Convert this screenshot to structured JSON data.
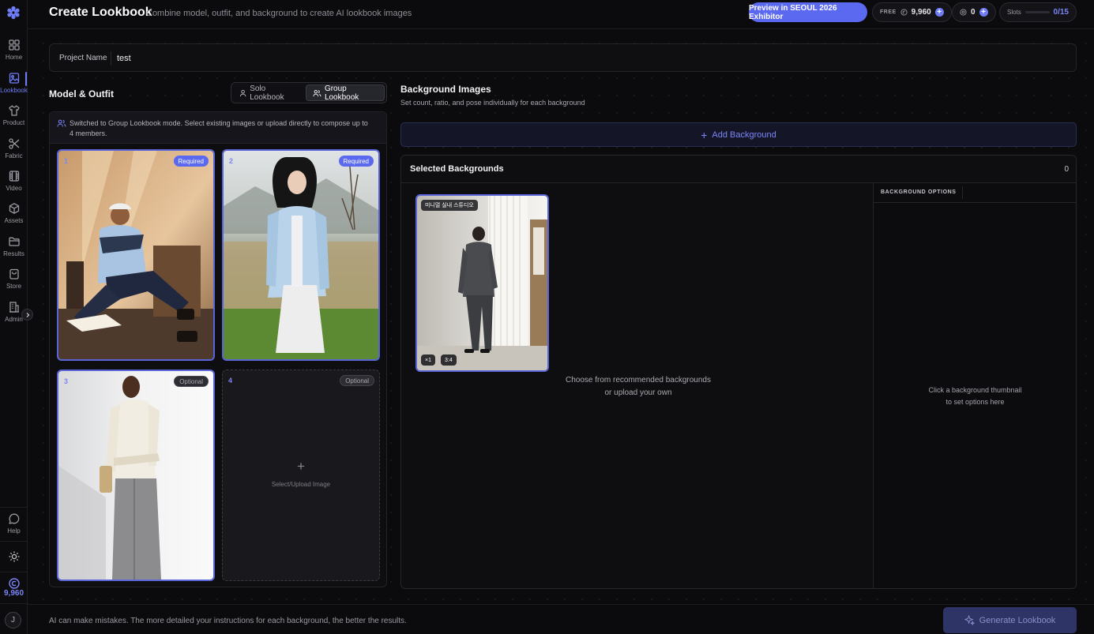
{
  "sidebar": {
    "items": [
      {
        "label": "Home",
        "icon": "home-grid-icon"
      },
      {
        "label": "Lookbook",
        "icon": "lookbook-image-icon"
      },
      {
        "label": "Product",
        "icon": "shirt-icon"
      },
      {
        "label": "Fabric",
        "icon": "scissors-icon"
      },
      {
        "label": "Video",
        "icon": "film-icon"
      },
      {
        "label": "Assets",
        "icon": "cube-icon"
      },
      {
        "label": "Results",
        "icon": "folder-icon"
      },
      {
        "label": "Store",
        "icon": "bag-icon"
      },
      {
        "label": "Admin",
        "icon": "building-icon"
      }
    ],
    "help_label": "Help",
    "credit_value": "9,960",
    "avatar_initial": "J"
  },
  "header": {
    "title": "Create Lookbook",
    "subtitle": "Combine model, outfit, and background to create AI lookbook images",
    "preview_button": "Preview in SEOUL 2026 Exhibitor",
    "plan_label": "FREE",
    "credits": "9,960",
    "coins": "0",
    "slots_label": "Slots",
    "slots_value": "0/15"
  },
  "project": {
    "label": "Project Name",
    "value": "test"
  },
  "model_outfit": {
    "title": "Model & Outfit",
    "mode_solo": "Solo Lookbook",
    "mode_group": "Group Lookbook",
    "info": "Switched to Group Lookbook mode. Select existing images or upload directly to compose up to 4 members.",
    "slots": [
      {
        "number": "1",
        "badge": "Required"
      },
      {
        "number": "2",
        "badge": "Required"
      },
      {
        "number": "3",
        "badge": "Optional"
      },
      {
        "number": "4",
        "badge": "Optional",
        "upload_label": "Select/Upload Image"
      }
    ]
  },
  "background": {
    "title": "Background Images",
    "subtitle": "Set count, ratio, and pose individually for each background",
    "add_button": "Add Background",
    "selected_title": "Selected Backgrounds",
    "selected_count": "0",
    "thumb_label": "미니멀 실내 스튜디오",
    "thumb_count": "×1",
    "thumb_ratio": "3:4",
    "choose_line1": "Choose from recommended backgrounds",
    "choose_line2": "or upload your own",
    "options_title": "BACKGROUND OPTIONS",
    "options_hint_line1": "Click a background thumbnail",
    "options_hint_line2": "to set options here"
  },
  "footer": {
    "disclaimer": "AI can make mistakes. The more detailed your instructions for each background, the better the results.",
    "generate_button": "Generate Lookbook"
  },
  "colors": {
    "accent": "#5b69f0",
    "accent_light": "#7b86f8",
    "background": "#0b0b0d"
  }
}
